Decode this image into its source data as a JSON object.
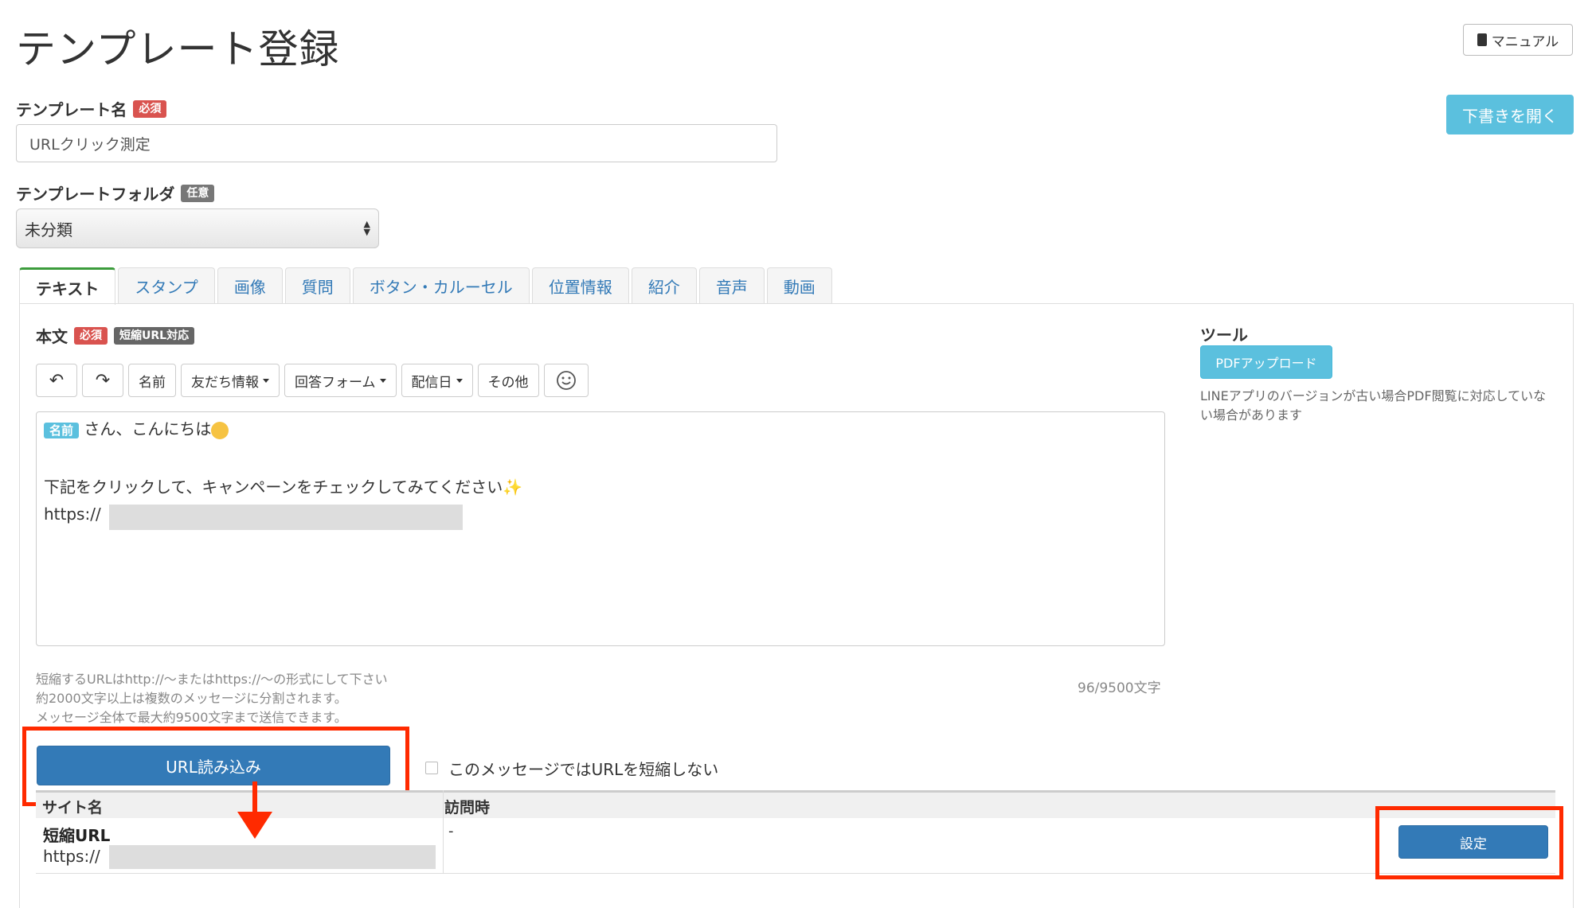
{
  "page": {
    "title": "テンプレート登録"
  },
  "header": {
    "manual_label": "マニュアル",
    "draft_label": "下書きを開く"
  },
  "form": {
    "name_label": "テンプレート名",
    "required_badge": "必須",
    "name_value": "URLクリック測定",
    "folder_label": "テンプレートフォルダ",
    "optional_badge": "任意",
    "folder_value": "未分類"
  },
  "tabs": [
    {
      "label": "テキスト",
      "active": true
    },
    {
      "label": "スタンプ"
    },
    {
      "label": "画像"
    },
    {
      "label": "質問"
    },
    {
      "label": "ボタン・カルーセル"
    },
    {
      "label": "位置情報"
    },
    {
      "label": "紹介"
    },
    {
      "label": "音声"
    },
    {
      "label": "動画"
    }
  ],
  "body": {
    "label": "本文",
    "required_badge": "必須",
    "short_url_badge": "短縮URL対応"
  },
  "toolbar": {
    "undo_icon": "undo-icon",
    "redo_icon": "redo-icon",
    "name_btn": "名前",
    "friend_info": "友だち情報",
    "answer_form": "回答フォーム",
    "delivery_date": "配信日",
    "other": "その他",
    "emoji_icon": "smile-icon"
  },
  "editor": {
    "name_tag": "名前",
    "line1": "さん、こんにちは",
    "line2": "下記をクリックして、キャンペーンをチェックしてみてください",
    "line3_prefix": "https://"
  },
  "hints": {
    "hint1": "短縮するURLはhttp://〜またはhttps://〜の形式にして下さい",
    "hint2": "約2000文字以上は複数のメッセージに分割されます。",
    "hint3": "メッセージ全体で最大約9500文字まで送信できます。",
    "counter": "96/9500文字"
  },
  "tool": {
    "title": "ツール",
    "pdf_btn": "PDFアップロード",
    "pdf_note": "LINEアプリのバージョンが古い場合PDF閲覧に対応していない場合があります"
  },
  "url_section": {
    "load_btn": "URL読み込み",
    "no_shorten_label": "このメッセージではURLを短縮しない",
    "col_site": "サイト名",
    "col_visit": "訪問時",
    "short_url_label": "短縮URL",
    "short_url_prefix": "https://",
    "visit_value": "-",
    "set_btn": "設定"
  },
  "colors": {
    "accent_red": "#ff2a00",
    "primary": "#337ab7",
    "info": "#5bc0de"
  }
}
